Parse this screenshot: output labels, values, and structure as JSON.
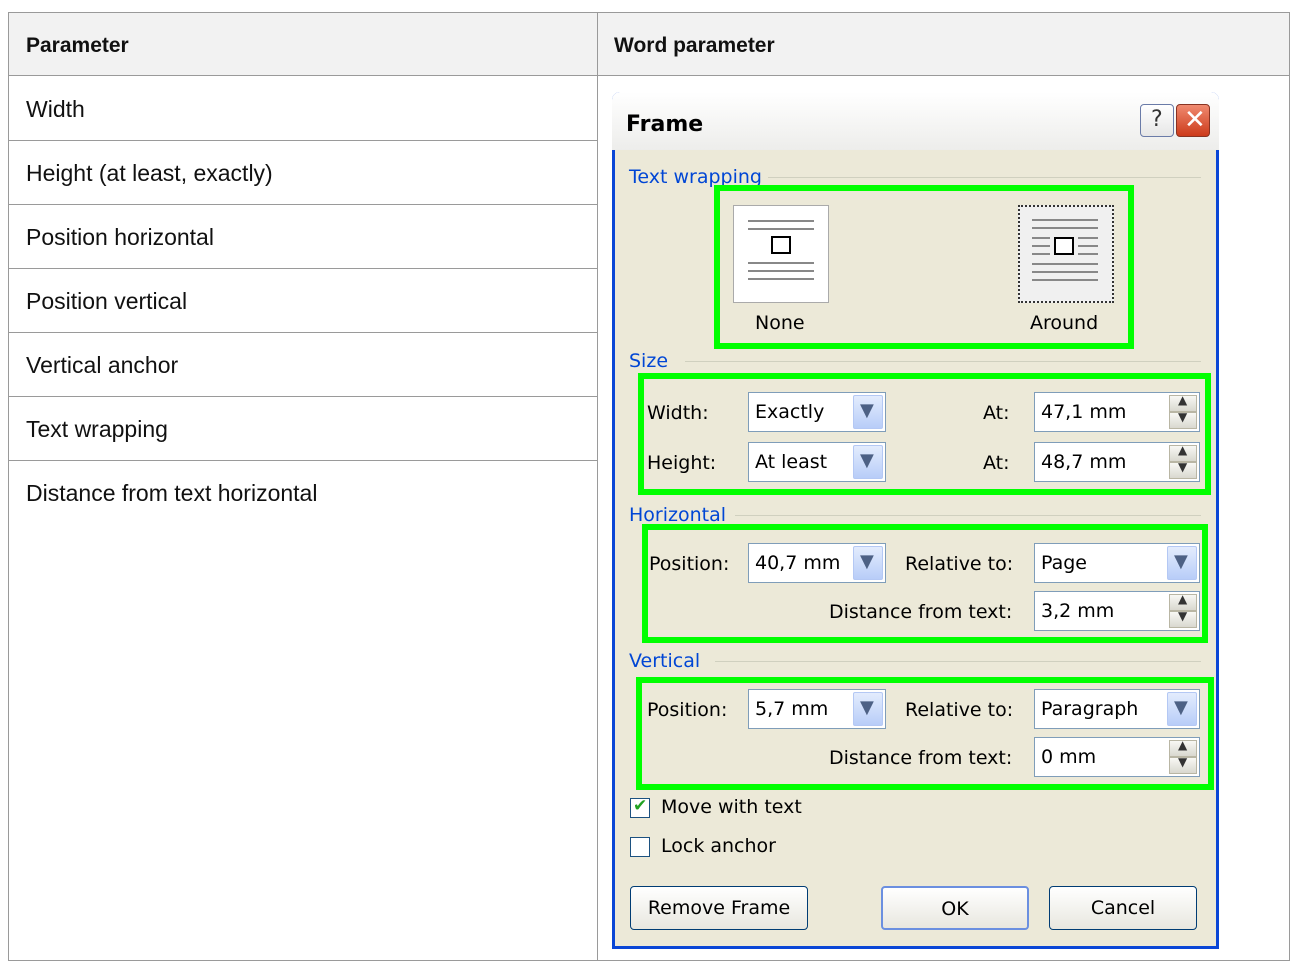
{
  "table": {
    "headers": [
      "Parameter",
      "Word parameter"
    ],
    "rows": [
      "Width",
      "Height (at least, exactly)",
      "Position horizontal",
      "Position vertical",
      "Vertical anchor",
      "Text wrapping",
      "Distance from text horizontal"
    ]
  },
  "dialog": {
    "title": "Frame",
    "help_icon": "help-icon",
    "close_icon": "close-icon",
    "text_wrapping": {
      "legend": "Text wrapping",
      "options": [
        "None",
        "Around"
      ],
      "selected": "Around"
    },
    "size": {
      "legend": "Size",
      "width_label": "Width:",
      "width_mode": "Exactly",
      "width_at_label": "At:",
      "width_at": "47,1 mm",
      "height_label": "Height:",
      "height_mode": "At least",
      "height_at_label": "At:",
      "height_at": "48,7 mm"
    },
    "horizontal": {
      "legend": "Horizontal",
      "position_label": "Position:",
      "position": "40,7 mm",
      "relative_label": "Relative to:",
      "relative": "Page",
      "distance_label": "Distance from text:",
      "distance": "3,2 mm"
    },
    "vertical": {
      "legend": "Vertical",
      "position_label": "Position:",
      "position": "5,7 mm",
      "relative_label": "Relative to:",
      "relative": "Paragraph",
      "distance_label": "Distance from text:",
      "distance": "0 mm"
    },
    "move_with_text": {
      "label": "Move with text",
      "checked": true
    },
    "lock_anchor": {
      "label": "Lock anchor",
      "checked": false
    },
    "buttons": {
      "remove": "Remove Frame",
      "ok": "OK",
      "cancel": "Cancel"
    },
    "highlight_color": "#00ff00"
  }
}
